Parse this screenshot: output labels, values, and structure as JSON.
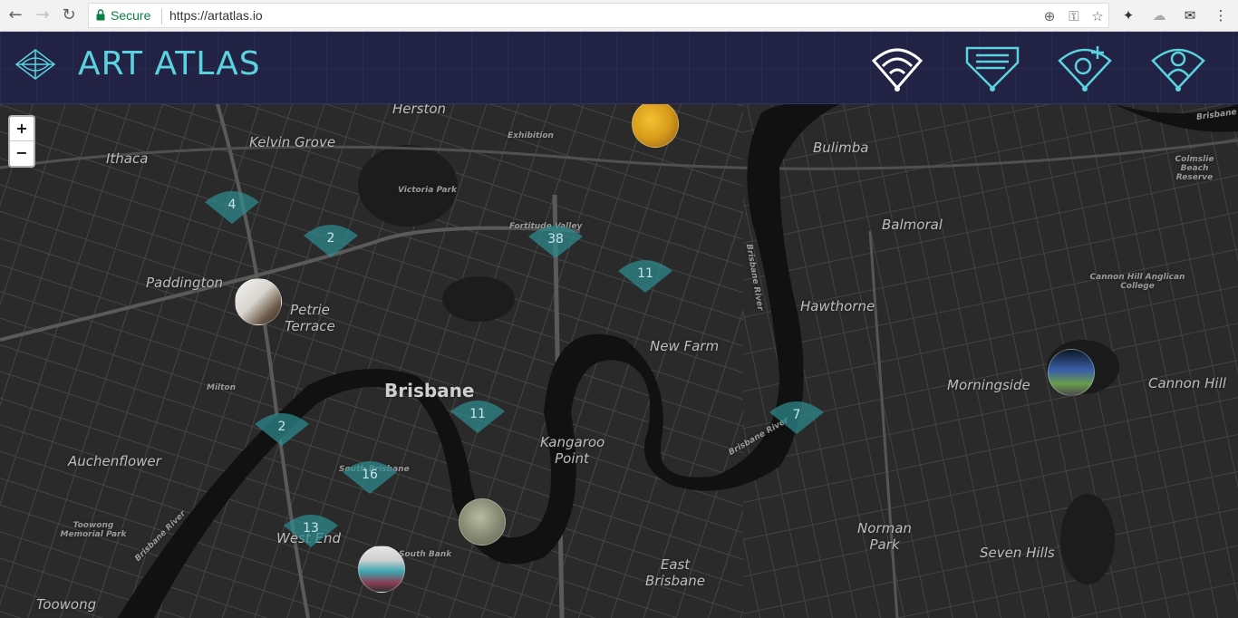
{
  "browser": {
    "secure_label": "Secure",
    "url": "https://artatlas.io",
    "icons": [
      "back-arrow-icon",
      "forward-arrow-icon",
      "reload-icon",
      "lock-icon",
      "location-icon",
      "key-icon",
      "star-icon",
      "extension-icon",
      "cloud-icon",
      "mail-icon",
      "menu-dots-icon"
    ]
  },
  "app": {
    "title": "ART ATLAS",
    "accent_color": "#5ad3df",
    "header_bg": "#222244",
    "nav_buttons": [
      {
        "name": "nearby",
        "icon": "signal-fan-icon"
      },
      {
        "name": "list",
        "icon": "list-fan-icon"
      },
      {
        "name": "add-artwork",
        "icon": "add-location-icon"
      },
      {
        "name": "profile",
        "icon": "user-fan-icon"
      }
    ]
  },
  "map": {
    "zoom_in": "+",
    "zoom_out": "−",
    "places": {
      "herston": "Herston",
      "kelvin_grove": "Kelvin Grove",
      "exhibition": "Exhibition",
      "ithaca": "Ithaca",
      "victoria_park": "Victoria Park",
      "bulimba": "Bulimba",
      "colmslie": "Colmslie Beach Reserve",
      "brisbane_ne": "Brisbane",
      "balmoral": "Balmoral",
      "fortitude_valley": "Fortitude Valley",
      "paddington": "Paddington",
      "petrie_terrace": "Petrie Terrace",
      "hawthorne": "Hawthorne",
      "cannon_hill_college": "Cannon Hill Anglican College",
      "new_farm": "New Farm",
      "milton": "Milton",
      "brisbane": "Brisbane",
      "morningside": "Morningside",
      "cannon_hill": "Cannon Hill",
      "kangaroo_point": "Kangaroo Point",
      "auchenflower": "Auchenflower",
      "south_brisbane": "South Brisbane",
      "toowong_memorial": "Toowong Memorial Park",
      "west_end": "West End",
      "south_bank": "South Bank",
      "norman_park": "Norman Park",
      "east_brisbane": "East Brisbane",
      "seven_hills": "Seven Hills",
      "toowong": "Toowong",
      "brisbane_river_1": "Brisbane River",
      "brisbane_river_2": "Brisbane River",
      "brisbane_river_3": "Brisbane River"
    },
    "clusters": [
      "4",
      "2",
      "38",
      "11",
      "2",
      "11",
      "7",
      "16",
      "13"
    ],
    "cluster_color": "#2e8f93"
  }
}
